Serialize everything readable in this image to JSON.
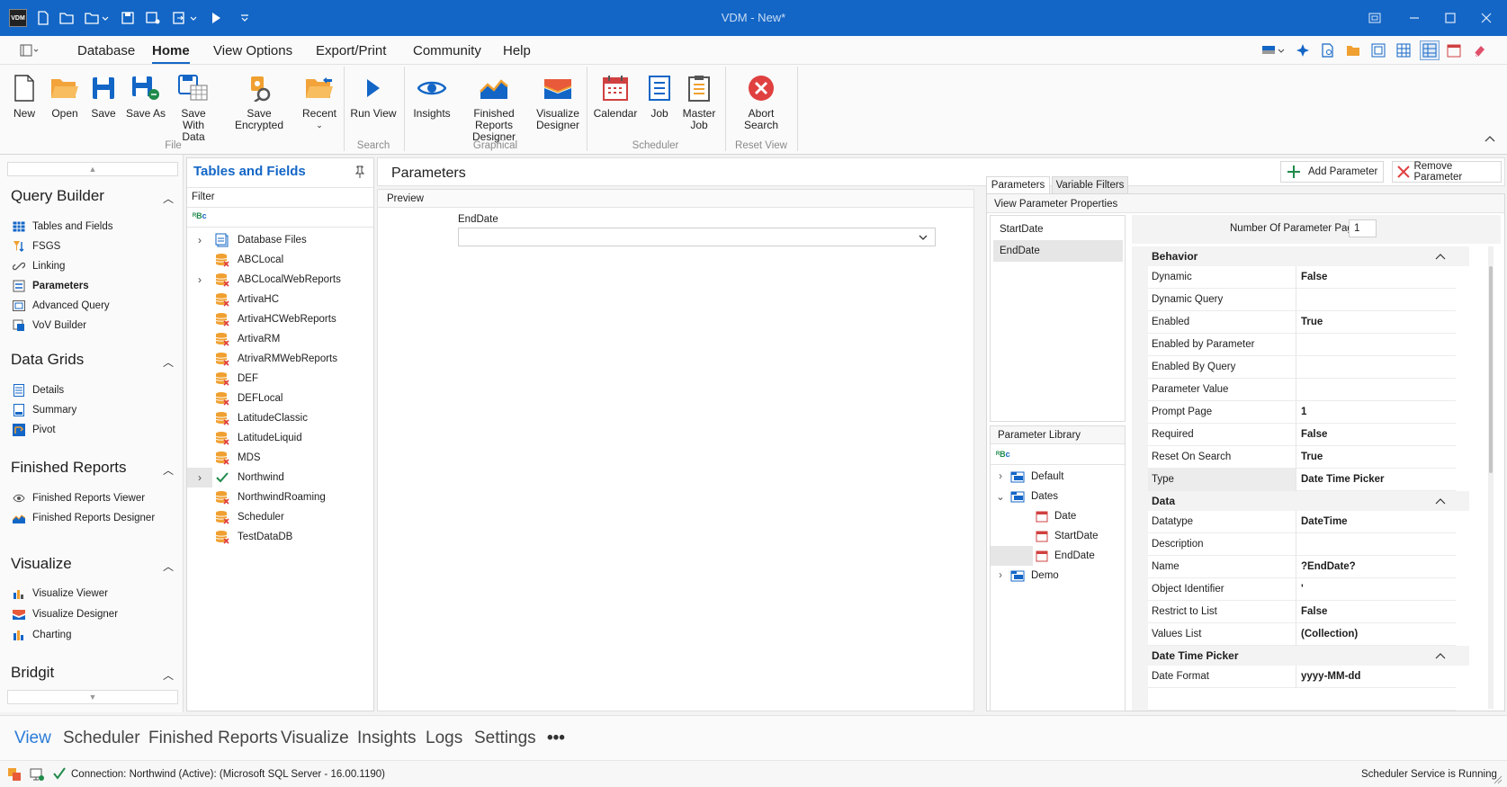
{
  "window": {
    "title": "VDM - New*",
    "logo": "VDM"
  },
  "menu": {
    "items": [
      "Database",
      "Home",
      "View Options",
      "Export/Print",
      "Community",
      "Help"
    ],
    "active": "Home"
  },
  "ribbon": {
    "groups": [
      {
        "label": "File",
        "buttons": [
          "New",
          "Open",
          "Save",
          "Save As",
          "Save With Data",
          "Save Encrypted",
          "Recent"
        ]
      },
      {
        "label": "Search",
        "buttons": [
          "Run View"
        ]
      },
      {
        "label": "Graphical",
        "buttons": [
          "Insights",
          "Finished Reports Designer",
          "Visualize Designer"
        ]
      },
      {
        "label": "Scheduler",
        "buttons": [
          "Calendar",
          "Job",
          "Master Job"
        ]
      },
      {
        "label": "Reset View",
        "buttons": [
          "Abort Search"
        ]
      }
    ],
    "labels": {
      "new": "New",
      "open": "Open",
      "save": "Save",
      "save_as": "Save As",
      "save_with_data_1": "Save With",
      "save_with_data_2": "Data",
      "save_encrypted": "Save Encrypted",
      "recent": "Recent",
      "run_view": "Run View",
      "insights": "Insights",
      "frd_1": "Finished Reports",
      "frd_2": "Designer",
      "vd_1": "Visualize",
      "vd_2": "Designer",
      "calendar": "Calendar",
      "job": "Job",
      "master_job_1": "Master",
      "master_job_2": "Job",
      "abort_1": "Abort",
      "abort_2": "Search",
      "g_file": "File",
      "g_search": "Search",
      "g_graphical": "Graphical",
      "g_scheduler": "Scheduler",
      "g_reset": "Reset View"
    }
  },
  "nav": {
    "query_builder": {
      "title": "Query Builder",
      "items": [
        "Tables and Fields",
        "FSGS",
        "Linking",
        "Parameters",
        "Advanced Query",
        "VoV Builder"
      ],
      "active": "Parameters"
    },
    "data_grids": {
      "title": "Data Grids",
      "items": [
        "Details",
        "Summary",
        "Pivot"
      ]
    },
    "finished_reports": {
      "title": "Finished Reports",
      "items": [
        "Finished Reports Viewer",
        "Finished Reports Designer"
      ]
    },
    "visualize": {
      "title": "Visualize",
      "items": [
        "Visualize Viewer",
        "Visualize Designer",
        "Charting"
      ]
    },
    "bridgit": {
      "title": "Bridgit"
    }
  },
  "tables_panel": {
    "title": "Tables and Fields",
    "filter_label": "Filter",
    "items": [
      "Database Files",
      "ABCLocal",
      "ABCLocalWebReports",
      "ArtivaHC",
      "ArtivaHCWebReports",
      "ArtivaRM",
      "AtrivaRMWebReports",
      "DEF",
      "DEFLocal",
      "LatitudeClassic",
      "LatitudeLiquid",
      "MDS",
      "Northwind",
      "NorthwindRoaming",
      "Scheduler",
      "TestDataDB"
    ]
  },
  "parameters": {
    "title": "Parameters",
    "add_button": "Add Parameter",
    "remove_button": "Remove Parameter",
    "preview_label": "Preview",
    "preview_field_label": "EndDate",
    "tabs": [
      "Parameters",
      "Variable Filters"
    ],
    "active_tab": "Parameters",
    "view_props_label": "View Parameter Properties",
    "param_list": [
      "StartDate",
      "EndDate"
    ],
    "selected_param": "EndDate",
    "pages_label": "Number Of Parameter Pages",
    "pages_value": "1",
    "library_label": "Parameter Library",
    "library": {
      "default": "Default",
      "dates": "Dates",
      "date": "Date",
      "start": "StartDate",
      "end": "EndDate",
      "demo": "Demo"
    },
    "categories": {
      "behavior": {
        "title": "Behavior",
        "rows": [
          [
            "Dynamic",
            "False"
          ],
          [
            "Dynamic Query",
            ""
          ],
          [
            "Enabled",
            "True"
          ],
          [
            "Enabled by Parameter",
            ""
          ],
          [
            "Enabled By Query",
            ""
          ],
          [
            "Parameter Value",
            ""
          ],
          [
            "Prompt Page",
            "1"
          ],
          [
            "Required",
            "False"
          ],
          [
            "Reset On Search",
            "True"
          ],
          [
            "Type",
            "Date Time Picker"
          ]
        ]
      },
      "data": {
        "title": "Data",
        "rows": [
          [
            "Datatype",
            "DateTime"
          ],
          [
            "Description",
            ""
          ],
          [
            "Name",
            "?EndDate?"
          ],
          [
            "Object Identifier",
            "'"
          ],
          [
            "Restrict to List",
            "False"
          ],
          [
            "Values List",
            "(Collection)"
          ]
        ]
      },
      "dtp": {
        "title": "Date Time Picker",
        "rows": [
          [
            "Date Format",
            "yyyy-MM-dd"
          ]
        ]
      }
    }
  },
  "bottom_tabs": {
    "items": [
      "View",
      "Scheduler",
      "Finished Reports",
      "Visualize",
      "Insights",
      "Logs",
      "Settings"
    ],
    "active": "View",
    "more": "•••"
  },
  "status": {
    "connection": "Connection: Northwind (Active): (Microsoft SQL Server - 16.00.1190)",
    "service": "Scheduler Service is Running"
  },
  "colors": {
    "accent": "#1366c6",
    "orange": "#f0a030",
    "red": "#e04040"
  }
}
